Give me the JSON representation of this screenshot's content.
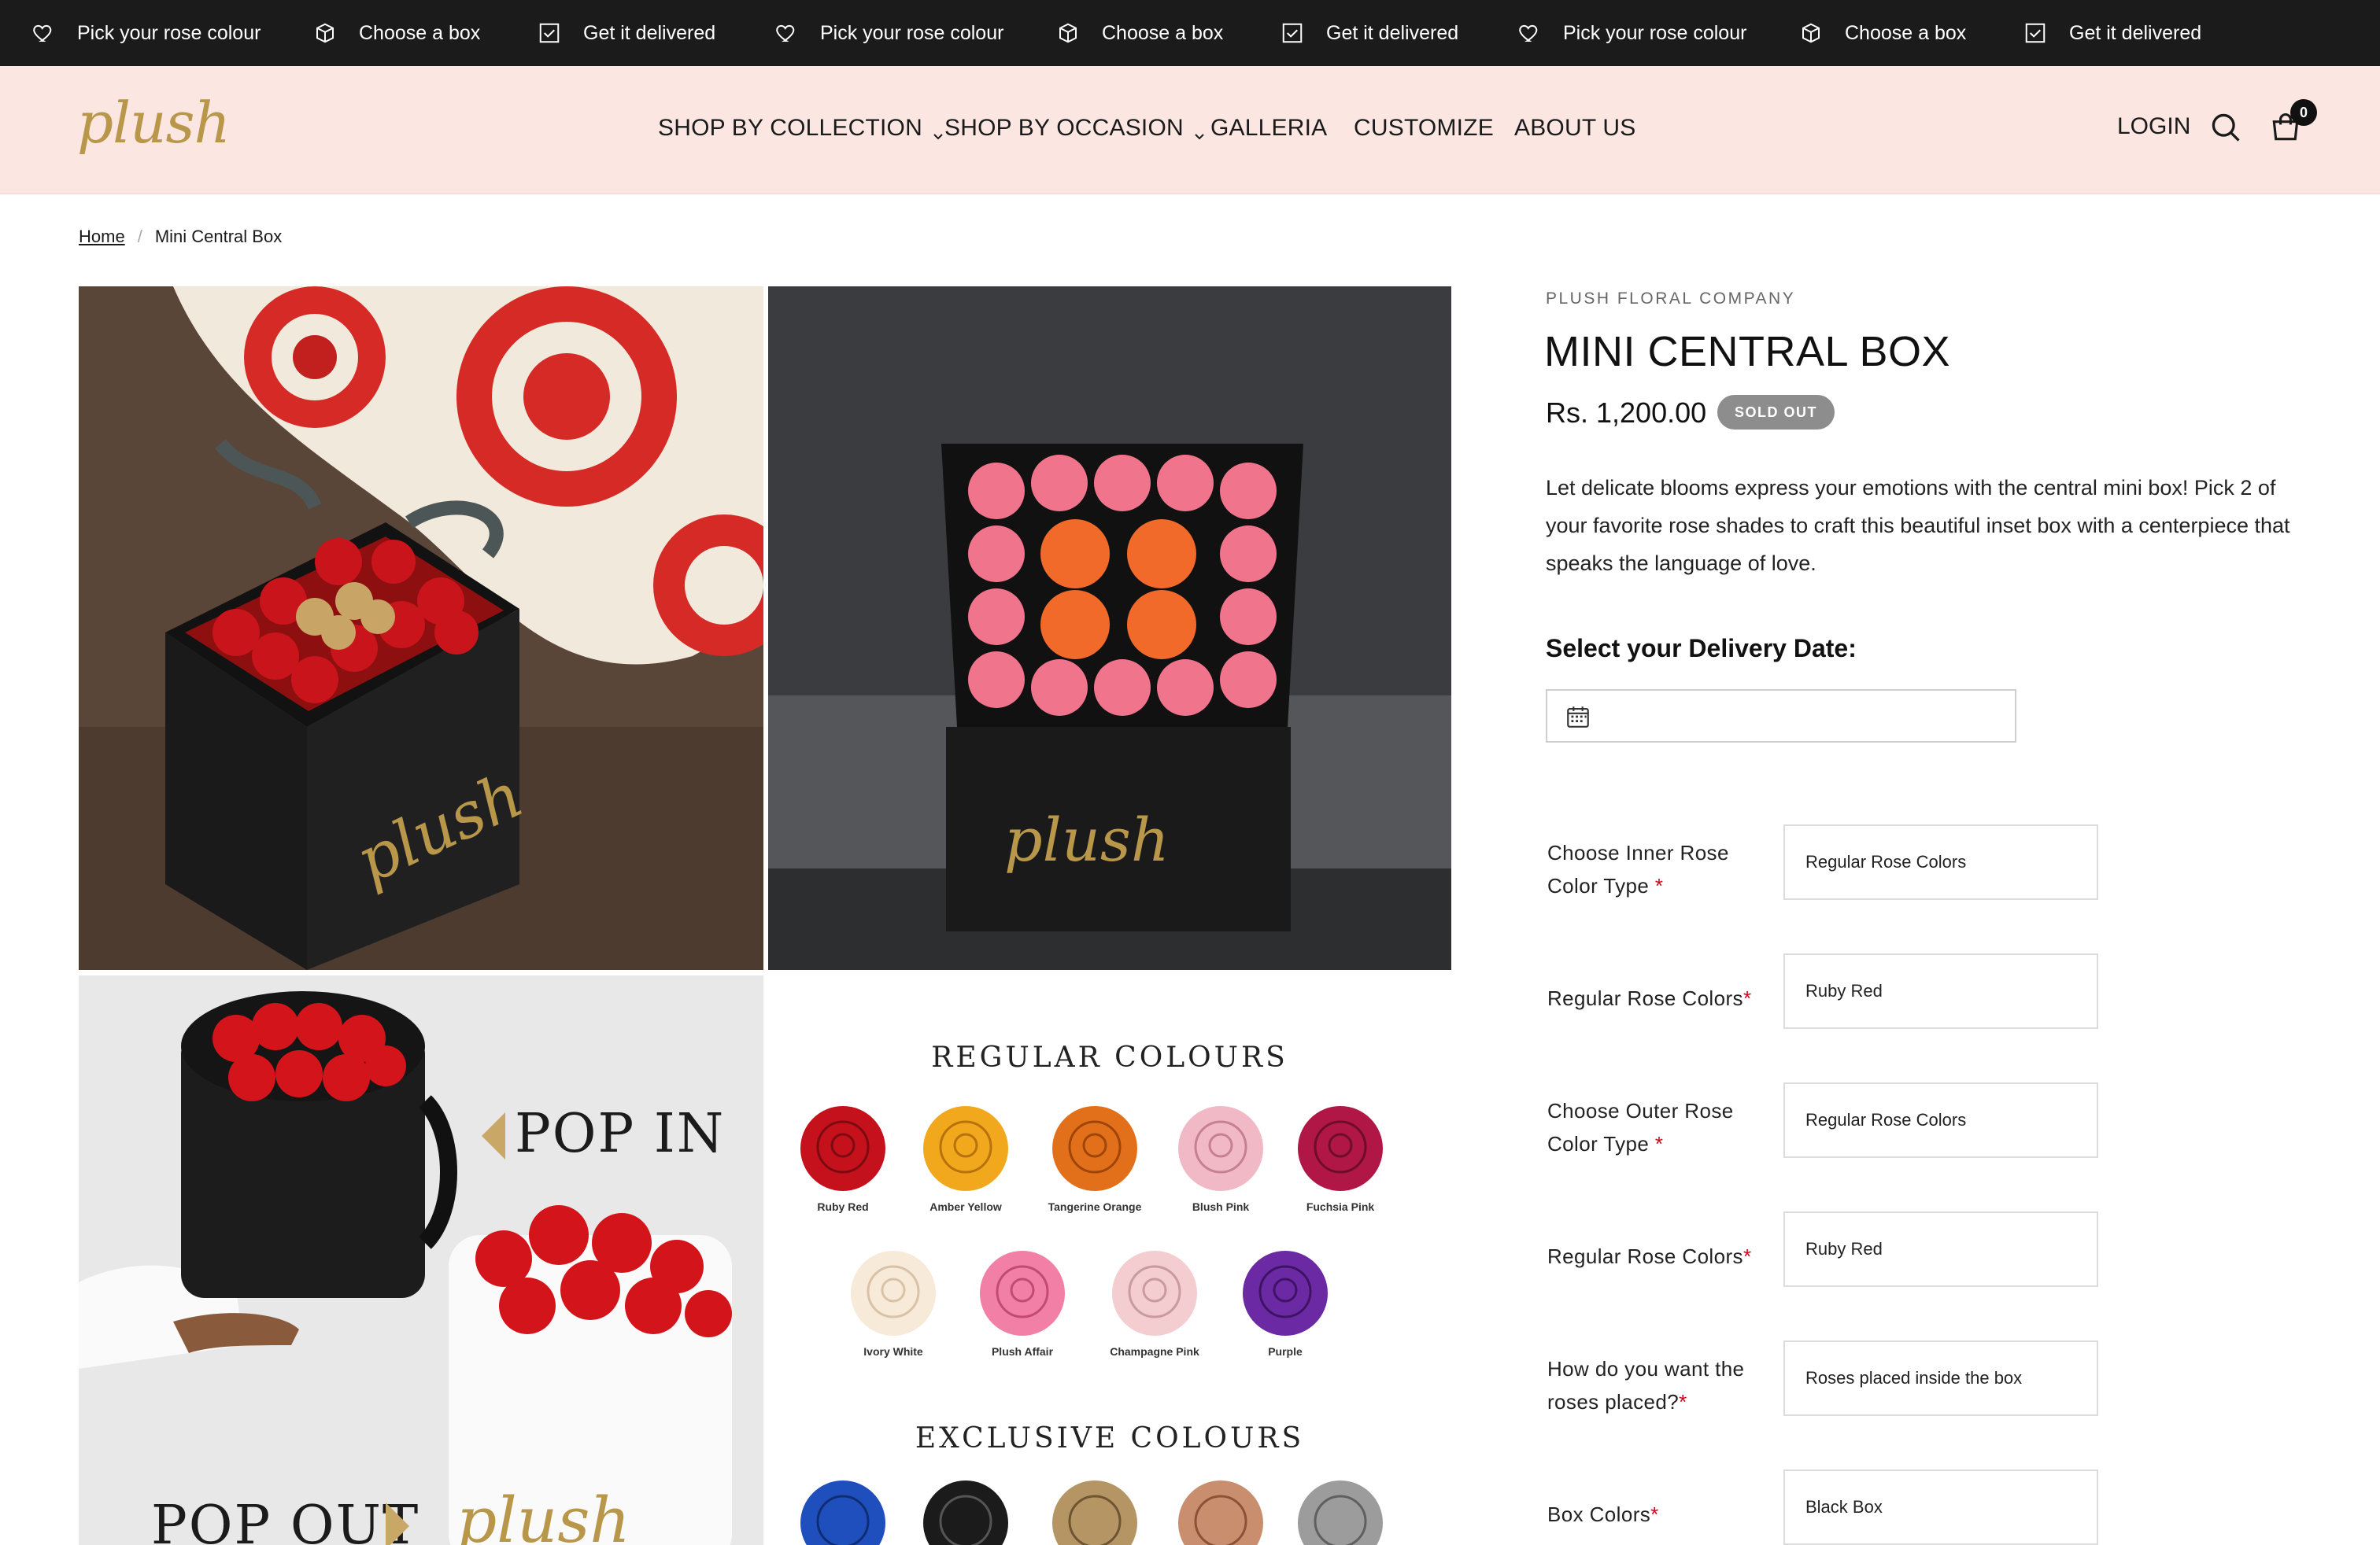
{
  "announcement": {
    "items": [
      {
        "icon": "heart-icon",
        "label": "Pick your rose colour"
      },
      {
        "icon": "box-icon",
        "label": "Choose a box"
      },
      {
        "icon": "checkbox-icon",
        "label": "Get it delivered"
      },
      {
        "icon": "heart-icon",
        "label": "Pick your rose colour"
      },
      {
        "icon": "box-icon",
        "label": "Choose a box"
      },
      {
        "icon": "checkbox-icon",
        "label": "Get it delivered"
      },
      {
        "icon": "heart-icon",
        "label": "Pick your rose colour"
      },
      {
        "icon": "box-icon",
        "label": "Choose a box"
      },
      {
        "icon": "checkbox-icon",
        "label": "Get it delivered"
      }
    ]
  },
  "header": {
    "logo": "plush",
    "nav": [
      {
        "label": "SHOP BY COLLECTION",
        "dropdown": true
      },
      {
        "label": "SHOP BY OCCASION",
        "dropdown": true
      },
      {
        "label": "GALLERIA",
        "dropdown": false
      },
      {
        "label": "CUSTOMIZE",
        "dropdown": false
      },
      {
        "label": "ABOUT US",
        "dropdown": false
      }
    ],
    "login": "LOGIN",
    "cart_count": "0"
  },
  "breadcrumb": {
    "home": "Home",
    "separator": "/",
    "current": "Mini Central Box"
  },
  "gallery": {
    "box_brand": "plush",
    "pop_in": "POP IN",
    "pop_out": "POP OUT",
    "regular_heading": "REGULAR COLOURS",
    "exclusive_heading": "EXCLUSIVE COLOURS",
    "regular_colours": [
      {
        "name": "Ruby Red",
        "color": "#c4111b"
      },
      {
        "name": "Amber Yellow",
        "color": "#f2a81d"
      },
      {
        "name": "Tangerine Orange",
        "color": "#e2701b"
      },
      {
        "name": "Blush Pink",
        "color": "#f1b9c6"
      },
      {
        "name": "Fuchsia Pink",
        "color": "#b01646"
      },
      {
        "name": "Ivory White",
        "color": "#f8ead9"
      },
      {
        "name": "Plush Affair",
        "color": "#f27fa6"
      },
      {
        "name": "Champagne Pink",
        "color": "#f3cdd0"
      },
      {
        "name": "Purple",
        "color": "#6b2aa3"
      }
    ],
    "exclusive_colours": [
      {
        "color": "#1f4fbd"
      },
      {
        "color": "#1b1b1b"
      },
      {
        "color": "#b59563"
      },
      {
        "color": "#c98e6e"
      },
      {
        "color": "#9c9c9c"
      }
    ]
  },
  "product": {
    "vendor": "PLUSH FLORAL COMPANY",
    "title": "MINI CENTRAL BOX",
    "price": "Rs. 1,200.00",
    "badge": "SOLD OUT",
    "description": "Let delicate blooms express your emotions with the central mini box! Pick 2 of your favorite rose shades to craft this beautiful inset box with a centerpiece that speaks the language of love.",
    "delivery_label": "Select your Delivery Date:",
    "delivery_value": "",
    "options": [
      {
        "label": "Choose Inner Rose Color Type",
        "required": "*",
        "value": "Regular Rose Colors"
      },
      {
        "label": "Regular Rose Colors",
        "required": "*",
        "value": "Ruby Red"
      },
      {
        "label": "Choose Outer Rose Color Type",
        "required": "*",
        "value": "Regular Rose Colors"
      },
      {
        "label": "Regular Rose Colors",
        "required": "*",
        "value": "Ruby Red"
      },
      {
        "label": "How do you want the roses placed?",
        "required": "*",
        "value": "Roses placed inside the box"
      },
      {
        "label": "Box Colors",
        "required": "*",
        "value": "Black Box"
      }
    ]
  },
  "colors": {
    "header_bg": "#fbe6e2",
    "announce_bg": "#1b1b1b",
    "logo_gold": "#b9974a",
    "badge_grey": "#8d8d8d",
    "required_red": "#d0021b"
  }
}
